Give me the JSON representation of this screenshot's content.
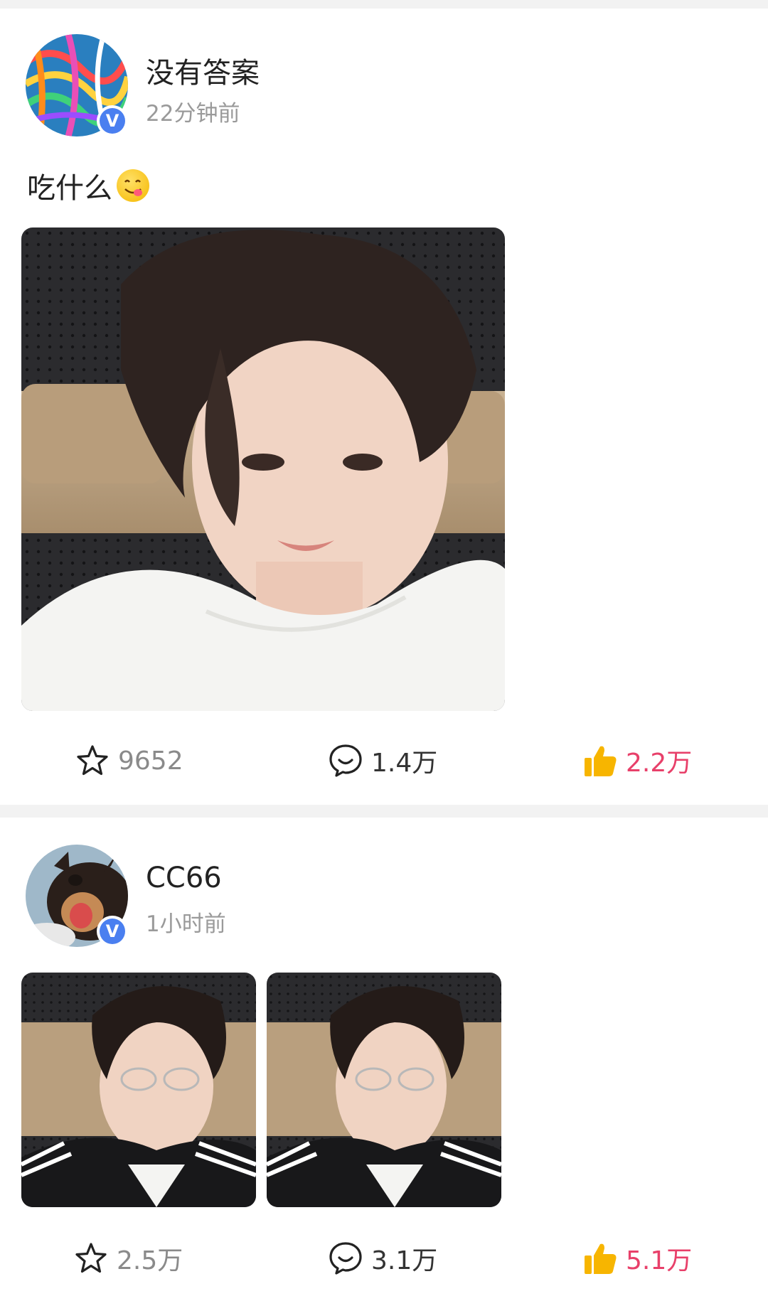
{
  "posts": [
    {
      "username": "没有答案",
      "time": "22分钟前",
      "text": "吃什么",
      "emoji": "yum-face-emoji",
      "actions": {
        "favorites": "9652",
        "comments": "1.4万",
        "likes": "2.2万"
      }
    },
    {
      "username": "CC66",
      "time": "1小时前",
      "actions": {
        "favorites": "2.5万",
        "comments": "3.1万",
        "likes": "5.1万"
      }
    }
  ],
  "icons": {
    "favorite": "star-icon",
    "comment": "comment-bubble-icon",
    "like": "thumbs-up-icon",
    "verified": "verified-v-icon"
  },
  "colors": {
    "like_active": "#e8406a",
    "thumb": "#f7b500",
    "verified": "#4a7ff0",
    "divider": "#f2f2f2"
  }
}
